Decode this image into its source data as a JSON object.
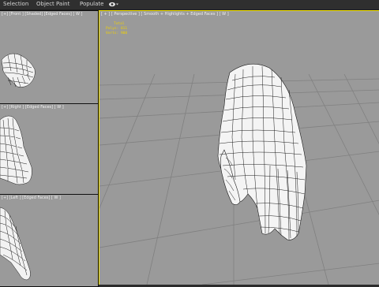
{
  "menu": {
    "items": [
      "Selection",
      "Object Paint",
      "Populate"
    ],
    "icon": "toggle-icon"
  },
  "viewports": {
    "top_left_label": "[+] [Front ] [Shaded] [Edged Faces] [ W ]",
    "middle_left_label": "[+] [Right ] [Edged Faces] [ W ]",
    "bottom_left_label": "[+] [Left ] [Edged Faces] [ W ]",
    "main_label": "[ + ] [ Perspective ] [ Smooth + Highlights + Edged Faces ] [ W ]"
  },
  "stats": {
    "total": "Total",
    "polys": "Polys: 811",
    "verts": "Verts: 900"
  },
  "colors": {
    "viewport_bg": "#9a9a9a",
    "grid": "#7e7e7e",
    "wire": "#1a1a1a",
    "mesh_fill": "#f2f2f2",
    "stats_text": "#f0d000"
  }
}
